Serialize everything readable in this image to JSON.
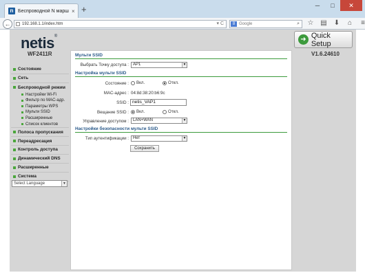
{
  "browser": {
    "tab_title": "Беспроводной N маршрутиз...",
    "new_tab": "+",
    "url": "192.168.1.1/index.htm",
    "search_placeholder": "Google",
    "search_engine_icon": "8"
  },
  "header": {
    "logo": "netis",
    "logo_tm": "®",
    "model": "WF2411R",
    "version": "V1.6.24610",
    "quick_setup": "Quick Setup"
  },
  "sidebar": {
    "items": [
      {
        "label": "Состояние"
      },
      {
        "label": "Сеть"
      },
      {
        "label": "Беспроводной режим"
      }
    ],
    "wireless_subitems": [
      {
        "label": "Настройки Wi-Fi"
      },
      {
        "label": "Фильтр по MAC-адр."
      },
      {
        "label": "Параметры WPS"
      },
      {
        "label": "Мульти SSID"
      },
      {
        "label": "Расширенные"
      },
      {
        "label": "Список клиентов"
      }
    ],
    "items_after": [
      {
        "label": "Полоса пропускания"
      },
      {
        "label": "Переадресация"
      },
      {
        "label": "Контроль доступа"
      },
      {
        "label": "Динамический DNS"
      },
      {
        "label": "Расширенные"
      },
      {
        "label": "Система"
      }
    ],
    "language_select": "Select Language"
  },
  "main": {
    "section1_title": "Мульти SSID",
    "select_ap_label": "Выбрать Точку доступа :",
    "select_ap_value": "AP1",
    "section2_title": "Настройка мульти SSID",
    "state_label": "Состояние :",
    "state_on": "Вкл.",
    "state_off": "Откл.",
    "mac_label": "MAC-адрес :",
    "mac_value": "04:8d:38:20:b6:9c",
    "ssid_label": "SSID :",
    "ssid_value": "netis_VAP1",
    "broadcast_label": "Вещание SSID :",
    "broadcast_on": "Вкл.",
    "broadcast_off": "Откл.",
    "access_label": "Управление доступом :",
    "access_value": "LAN+WAN",
    "section3_title": "Настройки безопасности мульти SSID",
    "auth_label": "Тип аутентификации :",
    "auth_value": "Нет",
    "save_button": "Сохранить"
  }
}
